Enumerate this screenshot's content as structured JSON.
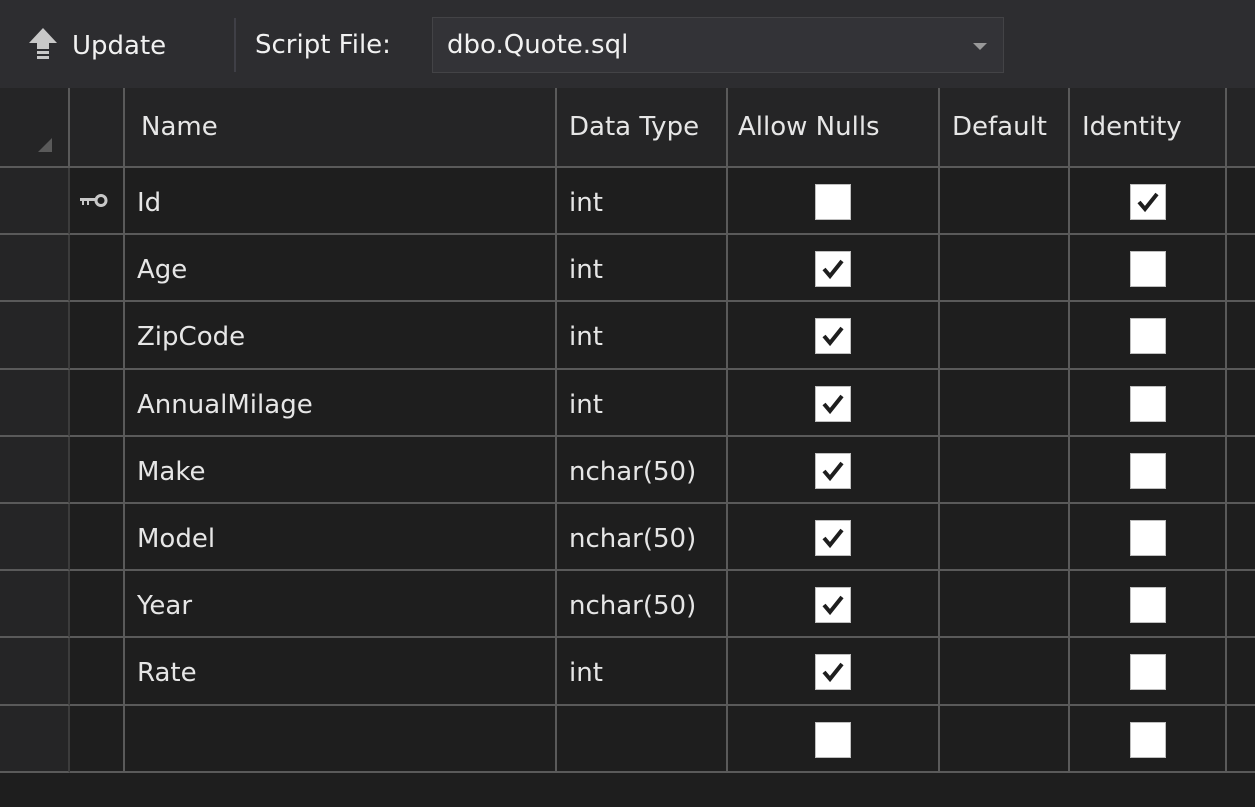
{
  "toolbar": {
    "update_label": "Update",
    "script_file_label": "Script File:",
    "script_file_value": "dbo.Quote.sql"
  },
  "columns": {
    "name": "Name",
    "data_type": "Data Type",
    "allow_nulls": "Allow Nulls",
    "default": "Default",
    "identity": "Identity"
  },
  "rows": [
    {
      "name": "Id",
      "data_type": "int",
      "allow_nulls": false,
      "default": "",
      "identity": true,
      "primary_key": true
    },
    {
      "name": "Age",
      "data_type": "int",
      "allow_nulls": true,
      "default": "",
      "identity": false,
      "primary_key": false
    },
    {
      "name": "ZipCode",
      "data_type": "int",
      "allow_nulls": true,
      "default": "",
      "identity": false,
      "primary_key": false
    },
    {
      "name": "AnnualMilage",
      "data_type": "int",
      "allow_nulls": true,
      "default": "",
      "identity": false,
      "primary_key": false
    },
    {
      "name": "Make",
      "data_type": "nchar(50)",
      "allow_nulls": true,
      "default": "",
      "identity": false,
      "primary_key": false
    },
    {
      "name": "Model",
      "data_type": "nchar(50)",
      "allow_nulls": true,
      "default": "",
      "identity": false,
      "primary_key": false
    },
    {
      "name": "Year",
      "data_type": "nchar(50)",
      "allow_nulls": true,
      "default": "",
      "identity": false,
      "primary_key": false
    },
    {
      "name": "Rate",
      "data_type": "int",
      "allow_nulls": true,
      "default": "",
      "identity": false,
      "primary_key": false
    },
    {
      "name": "",
      "data_type": "",
      "allow_nulls": false,
      "default": "",
      "identity": false,
      "primary_key": false
    }
  ],
  "icons": {
    "update": "upload-arrow-icon",
    "dropdown": "chevron-down-icon",
    "primary_key": "key-icon",
    "checkmark": "checkmark-icon"
  },
  "colors": {
    "background": "#1e1e1e",
    "toolbar": "#2d2d30",
    "grid_line": "#5a5a5a",
    "text": "#e6e6e6",
    "checkbox": "#ffffff"
  }
}
